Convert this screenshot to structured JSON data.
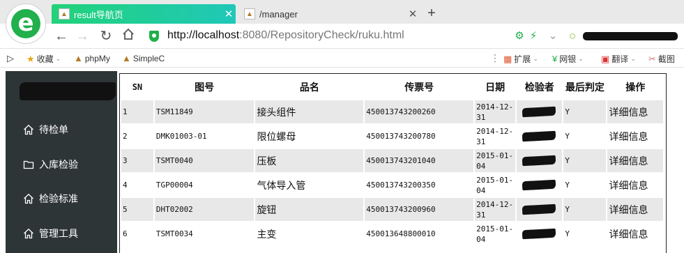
{
  "browser": {
    "tabs": [
      {
        "title": "result导航页",
        "active": true
      },
      {
        "title": "/manager",
        "active": false
      }
    ],
    "address": {
      "protocol_host": "http://localhost",
      "rest": ":8080/RepositoryCheck/ruku.html"
    },
    "bookmarks": [
      {
        "label": "收藏",
        "icon": "star-icon",
        "dropdown": true
      },
      {
        "label": "phpMy",
        "icon": "phpmyadmin-icon",
        "dropdown": false
      },
      {
        "label": "SimpleC",
        "icon": "simplec-icon",
        "dropdown": false
      }
    ],
    "right_tools": [
      {
        "label": "扩展",
        "icon": "extensions-icon"
      },
      {
        "label": "网银",
        "icon": "bank-icon"
      },
      {
        "label": "翻译",
        "icon": "translate-icon"
      },
      {
        "label": "截图",
        "icon": "screenshot-icon"
      }
    ],
    "colors": {
      "tab_active_start": "#22d27a",
      "tab_active_end": "#1fc8b8",
      "brand_green": "#21b04b"
    }
  },
  "sidebar": {
    "background": "#2e3537",
    "items": [
      {
        "label": "待检单",
        "icon": "home-icon"
      },
      {
        "label": "入库检验",
        "icon": "folder-icon"
      },
      {
        "label": "检验标准",
        "icon": "home-icon"
      },
      {
        "label": "管理工具",
        "icon": "home-icon"
      }
    ]
  },
  "table": {
    "headers": [
      "SN",
      "图号",
      "品名",
      "传票号",
      "日期",
      "检验者",
      "最后判定",
      "操作"
    ],
    "rows": [
      {
        "sn": "1",
        "drawing": "TSM11849",
        "name": "接头组件",
        "ticket": "450013743200260",
        "date": "2014-12-31",
        "verdict": "Y",
        "action": "详细信息"
      },
      {
        "sn": "2",
        "drawing": "DMK01003-01",
        "name": "限位螺母",
        "ticket": "450013743200780",
        "date": "2014-12-31",
        "verdict": "Y",
        "action": "详细信息"
      },
      {
        "sn": "3",
        "drawing": "TSMT0040",
        "name": "压板",
        "ticket": "450013743201040",
        "date": "2015-01-04",
        "verdict": "Y",
        "action": "详细信息"
      },
      {
        "sn": "4",
        "drawing": "TGP00004",
        "name": "气体导入管",
        "ticket": "450013743200350",
        "date": "2015-01-04",
        "verdict": "Y",
        "action": "详细信息"
      },
      {
        "sn": "5",
        "drawing": "DHT02002",
        "name": "旋钮",
        "ticket": "450013743200960",
        "date": "2014-12-31",
        "verdict": "Y",
        "action": "详细信息"
      },
      {
        "sn": "6",
        "drawing": "TSMT0034",
        "name": "主变",
        "ticket": "450013648800010",
        "date": "2015-01-04",
        "verdict": "Y",
        "action": "详细信息"
      }
    ]
  }
}
